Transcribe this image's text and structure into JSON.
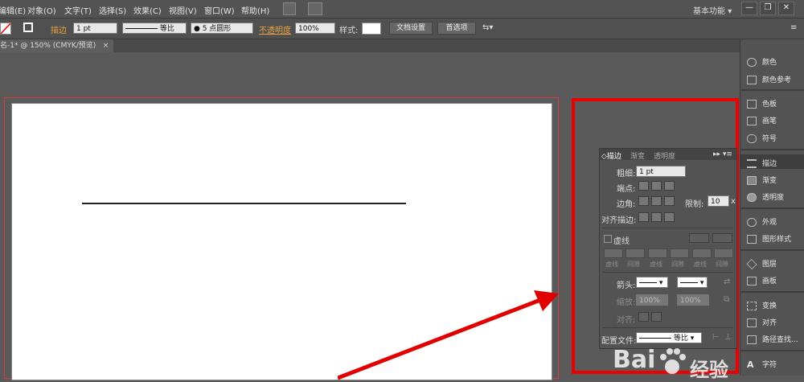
{
  "menubar": {
    "items": [
      "编辑(E)",
      "对象(O)",
      "文字(T)",
      "选择(S)",
      "效果(C)",
      "视图(V)",
      "窗口(W)",
      "帮助(H)"
    ],
    "workspace": "基本功能",
    "workspace_arrow": "▾",
    "min": "—",
    "max": "❐",
    "close": "✕"
  },
  "control": {
    "stroke_label": "描边",
    "stroke_value": "1 pt",
    "profile_value": "等比",
    "brush_value": "● 5 点圆形",
    "opacity_label": "不透明度",
    "opacity_value": "100%",
    "style_label": "样式:",
    "doc_setup": "文档设置",
    "prefs": "首选项",
    "arrange_icon": "⇆▾"
  },
  "document": {
    "tab_title": "名-1* @ 150% (CMYK/预览)",
    "tab_close": "×"
  },
  "stroke_panel": {
    "tabs": [
      "◇描边",
      "渐变",
      "透明度"
    ],
    "menu": "▸▸ ▾≡",
    "weight_label": "粗细:",
    "weight_value": "1 pt",
    "cap_label": "端点:",
    "corner_label": "边角:",
    "limit_label": "限制:",
    "limit_value": "10",
    "limit_unit": "x",
    "align_label": "对齐描边:",
    "dashed_label": "虚线",
    "dash_labels": [
      "虚线",
      "间隙",
      "虚线",
      "间隙",
      "虚线",
      "间隙"
    ],
    "arrow_label": "箭头:",
    "scale_label": "缩放:",
    "scale_value_1": "100%",
    "scale_value_2": "100%",
    "align_arrow_label": "对齐:",
    "profile_label": "配置文件:",
    "profile_value": "等比"
  },
  "dock": {
    "items": [
      "颜色",
      "颜色参考",
      "色板",
      "画笔",
      "符号",
      "描边",
      "渐变",
      "透明度",
      "外观",
      "图形样式",
      "图层",
      "画板",
      "变换",
      "对齐",
      "路径查找...",
      "字符"
    ]
  },
  "watermark": {
    "text": "Bai",
    "text2": "经验"
  },
  "colors": {
    "highlight": "#e00000",
    "arrow": "#e00000",
    "orange_label": "#e8a33d"
  }
}
